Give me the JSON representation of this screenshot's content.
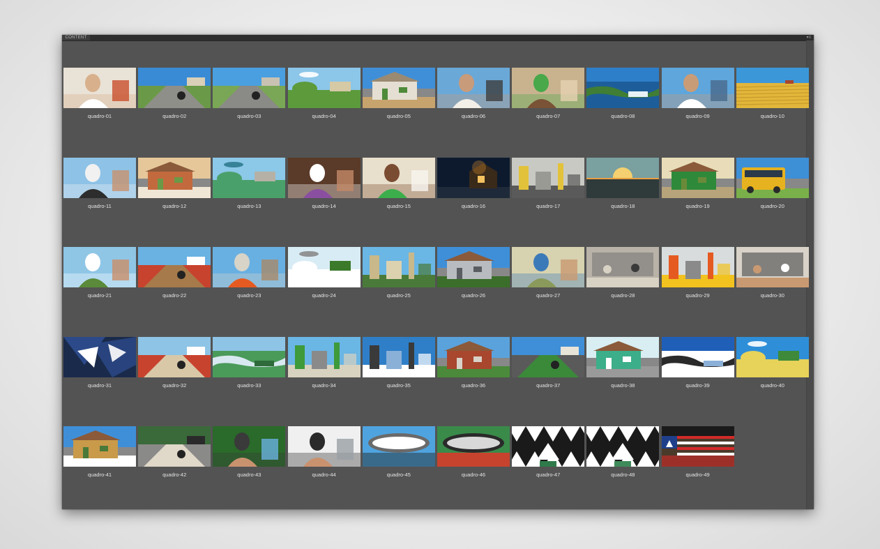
{
  "panel": {
    "tab_label": "CONTENT",
    "menu_icon": "panel-menu-icon"
  },
  "thumbnails": [
    {
      "label": "quadro-01",
      "scene": "person",
      "colors": [
        "#e9e2d6",
        "#ffffff",
        "#d8b08c",
        "#c9502d"
      ]
    },
    {
      "label": "quadro-02",
      "scene": "road",
      "colors": [
        "#3a8bd6",
        "#6a9a47",
        "#8e8f88",
        "#d9d0b7"
      ]
    },
    {
      "label": "quadro-03",
      "scene": "road",
      "colors": [
        "#4a9fe0",
        "#7aa755",
        "#8a8a86",
        "#c9c2b2"
      ]
    },
    {
      "label": "quadro-04",
      "scene": "landscape",
      "colors": [
        "#8cc6e8",
        "#5c9a3c",
        "#d5c9a6",
        "#ffffff"
      ]
    },
    {
      "label": "quadro-05",
      "scene": "building",
      "colors": [
        "#3f8fd8",
        "#e4dfd2",
        "#c7a36e",
        "#4e8a3a"
      ]
    },
    {
      "label": "quadro-06",
      "scene": "person",
      "colors": [
        "#6aa8d8",
        "#f2efe8",
        "#c89b7b",
        "#3d3d3d"
      ]
    },
    {
      "label": "quadro-07",
      "scene": "person",
      "colors": [
        "#c9b38f",
        "#7a5236",
        "#48a84a",
        "#e6d2b2"
      ]
    },
    {
      "label": "quadro-08",
      "scene": "water",
      "colors": [
        "#2e7fc9",
        "#1d5e9a",
        "#3f7e34",
        "#e8f2f6"
      ]
    },
    {
      "label": "quadro-09",
      "scene": "person",
      "colors": [
        "#5ea6dc",
        "#ffffff",
        "#c99c78",
        "#4a6a8c"
      ]
    },
    {
      "label": "quadro-10",
      "scene": "field",
      "colors": [
        "#3c97d9",
        "#e2b63a",
        "#c79a2b",
        "#f0d77a"
      ]
    },
    {
      "label": "quadro-11",
      "scene": "person",
      "colors": [
        "#8ec2e6",
        "#2d2d2d",
        "#f1f1f1",
        "#c8926e"
      ]
    },
    {
      "label": "quadro-12",
      "scene": "building",
      "colors": [
        "#e6c79a",
        "#c26a3e",
        "#f0e6d5",
        "#6a9a47"
      ]
    },
    {
      "label": "quadro-13",
      "scene": "landscape",
      "colors": [
        "#8cc8e8",
        "#4aa06a",
        "#b5b1a6",
        "#2d7a8e"
      ]
    },
    {
      "label": "quadro-14",
      "scene": "person",
      "colors": [
        "#5a3a28",
        "#8a4fa0",
        "#ffffff",
        "#c38a68"
      ]
    },
    {
      "label": "quadro-15",
      "scene": "person",
      "colors": [
        "#e8dfcc",
        "#3cae4b",
        "#7a4c32",
        "#f7f5f0"
      ]
    },
    {
      "label": "quadro-16",
      "scene": "night",
      "colors": [
        "#0d1a2e",
        "#d48a2a",
        "#1e2a3a",
        "#f5c260"
      ]
    },
    {
      "label": "quadro-17",
      "scene": "industrial",
      "colors": [
        "#c9c9c4",
        "#e2c23a",
        "#5a5a5a",
        "#9a9a94"
      ]
    },
    {
      "label": "quadro-18",
      "scene": "sunset",
      "colors": [
        "#f4d070",
        "#2f3a3a",
        "#7aa0a0",
        "#e8a040"
      ]
    },
    {
      "label": "quadro-19",
      "scene": "building",
      "colors": [
        "#e8ddb8",
        "#2e8a3a",
        "#b8a47a",
        "#6a8a3a"
      ]
    },
    {
      "label": "quadro-20",
      "scene": "vehicle",
      "colors": [
        "#3d8fd6",
        "#e7b21f",
        "#2a2a2a",
        "#7ab04a"
      ]
    },
    {
      "label": "quadro-21",
      "scene": "person",
      "colors": [
        "#8fc6e6",
        "#5a8a3a",
        "#ffffff",
        "#c98f6a"
      ]
    },
    {
      "label": "quadro-22",
      "scene": "road",
      "colors": [
        "#6ab2e2",
        "#c8432e",
        "#a67a4a",
        "#ffffff"
      ]
    },
    {
      "label": "quadro-23",
      "scene": "person",
      "colors": [
        "#69b0e2",
        "#e55a21",
        "#d8d4c8",
        "#a88a6a"
      ]
    },
    {
      "label": "quadro-24",
      "scene": "landscape",
      "colors": [
        "#d8ecf5",
        "#ffffff",
        "#3a7a2a",
        "#8a8a8a"
      ]
    },
    {
      "label": "quadro-25",
      "scene": "industrial",
      "colors": [
        "#6ab6e4",
        "#c9b88a",
        "#4a7a3a",
        "#dcd2b0"
      ]
    },
    {
      "label": "quadro-26",
      "scene": "building",
      "colors": [
        "#3f8fd8",
        "#b8bcc0",
        "#3b6e2a",
        "#5a5e62"
      ]
    },
    {
      "label": "quadro-27",
      "scene": "person",
      "colors": [
        "#d7d2b0",
        "#8a9a5a",
        "#3b7ab8",
        "#c99a72"
      ]
    },
    {
      "label": "quadro-28",
      "scene": "indoor",
      "colors": [
        "#b8b2a8",
        "#7a7a78",
        "#d8d2c4",
        "#3a3a3a"
      ]
    },
    {
      "label": "quadro-29",
      "scene": "industrial",
      "colors": [
        "#d8dcdc",
        "#e55a21",
        "#f2c21f",
        "#8a8a8a"
      ]
    },
    {
      "label": "quadro-30",
      "scene": "indoor",
      "colors": [
        "#d8d2c8",
        "#4a4a4a",
        "#c99a72",
        "#ffffff"
      ]
    },
    {
      "label": "quadro-31",
      "scene": "abstract",
      "colors": [
        "#2c4a8a",
        "#ffffff",
        "#1a2a4a",
        "#8ab0d8"
      ]
    },
    {
      "label": "quadro-32",
      "scene": "road",
      "colors": [
        "#8ec4e6",
        "#c8432e",
        "#d8c8a8",
        "#ffffff"
      ]
    },
    {
      "label": "quadro-33",
      "scene": "water",
      "colors": [
        "#8ec4e6",
        "#4a9a5a",
        "#d8e8f0",
        "#2e6a3a"
      ]
    },
    {
      "label": "quadro-34",
      "scene": "industrial",
      "colors": [
        "#6ab6e4",
        "#3e9a3a",
        "#d8d2c0",
        "#8a8a8a"
      ]
    },
    {
      "label": "quadro-35",
      "scene": "industrial",
      "colors": [
        "#2f7fc8",
        "#3a3a3a",
        "#ffffff",
        "#8ab0d8"
      ]
    },
    {
      "label": "quadro-36",
      "scene": "building",
      "colors": [
        "#5aa2dc",
        "#a8462e",
        "#4a8a3a",
        "#d8d2c8"
      ]
    },
    {
      "label": "quadro-37",
      "scene": "road",
      "colors": [
        "#3f8fd8",
        "#5a5a5a",
        "#3a8a3a",
        "#e8e4d8"
      ]
    },
    {
      "label": "quadro-38",
      "scene": "building",
      "colors": [
        "#d8eef2",
        "#3cae8a",
        "#9a9a9a",
        "#ffffff"
      ]
    },
    {
      "label": "quadro-39",
      "scene": "water",
      "colors": [
        "#1f5fb8",
        "#ffffff",
        "#2a2a2a",
        "#8ab0d8"
      ]
    },
    {
      "label": "quadro-40",
      "scene": "landscape",
      "colors": [
        "#2e8fd8",
        "#e7d25a",
        "#3e8a3a",
        "#ffffff"
      ]
    },
    {
      "label": "quadro-41",
      "scene": "building",
      "colors": [
        "#3f8fd8",
        "#c89a4a",
        "#ffffff",
        "#4a7a3a"
      ]
    },
    {
      "label": "quadro-42",
      "scene": "road",
      "colors": [
        "#3a6a3a",
        "#8a8a88",
        "#e0d8c8",
        "#2a2a2a"
      ]
    },
    {
      "label": "quadro-43",
      "scene": "person",
      "colors": [
        "#2a6a2a",
        "#c9926e",
        "#3a3a3a",
        "#6ab0e0"
      ]
    },
    {
      "label": "quadro-44",
      "scene": "person",
      "colors": [
        "#f0f0f0",
        "#c9926e",
        "#2a2a2a",
        "#9aa0a6"
      ]
    },
    {
      "label": "quadro-45",
      "scene": "stadium",
      "colors": [
        "#4fa4e0",
        "#6a6a6a",
        "#ffffff",
        "#3a6a8a"
      ]
    },
    {
      "label": "quadro-46",
      "scene": "stadium",
      "colors": [
        "#3a8a4a",
        "#2a2a2a",
        "#d8d8d8",
        "#c8432e"
      ]
    },
    {
      "label": "quadro-47",
      "scene": "pattern",
      "colors": [
        "#ffffff",
        "#1a1a1a",
        "#2e7a4a",
        "#c9926e"
      ]
    },
    {
      "label": "quadro-48",
      "scene": "pattern",
      "colors": [
        "#ffffff",
        "#1a1a1a",
        "#3e8a5a",
        "#c9926e"
      ]
    },
    {
      "label": "quadro-49",
      "scene": "flag",
      "colors": [
        "#1f3f8a",
        "#d42a2a",
        "#ffffff",
        "#1a1a1a"
      ]
    }
  ]
}
